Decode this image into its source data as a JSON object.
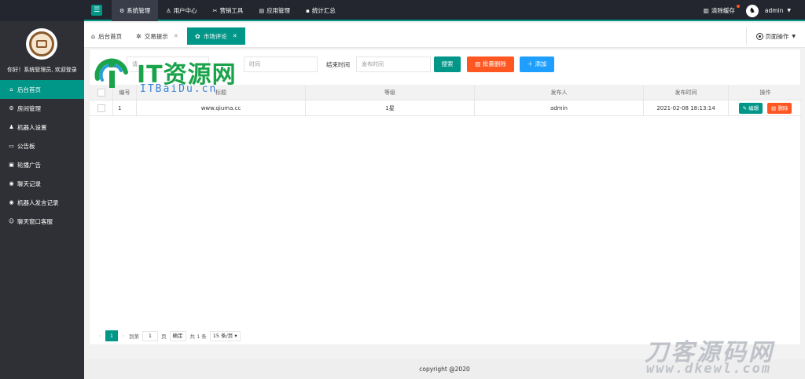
{
  "sidebar": {
    "welcome": "你好！系统管理员, 欢迎登录",
    "items": [
      {
        "icon": "home-icon",
        "glyph": "⌂",
        "label": "后台首页"
      },
      {
        "icon": "settings-icon",
        "glyph": "⚙",
        "label": "房间管理"
      },
      {
        "icon": "user-icon",
        "glyph": "♟",
        "label": "机器人设置"
      },
      {
        "icon": "board-icon",
        "glyph": "▭",
        "label": "公告板"
      },
      {
        "icon": "image-icon",
        "glyph": "▣",
        "label": "轮播广告"
      },
      {
        "icon": "chat-icon",
        "glyph": "◉",
        "label": "聊天记录"
      },
      {
        "icon": "robot-icon",
        "glyph": "◉",
        "label": "机器人发言记录"
      },
      {
        "icon": "service-icon",
        "glyph": "☺",
        "label": "聊天窗口客服"
      }
    ]
  },
  "topbar": {
    "tabs": [
      {
        "icon": "gear-icon",
        "glyph": "⚙",
        "label": "系统管理"
      },
      {
        "icon": "user-icon",
        "glyph": "♙",
        "label": "用户中心"
      },
      {
        "icon": "tools-icon",
        "glyph": "✂",
        "label": "营销工具"
      },
      {
        "icon": "app-icon",
        "glyph": "▤",
        "label": "应用管理"
      },
      {
        "icon": "stats-icon",
        "glyph": "▪",
        "label": "统计汇总"
      }
    ],
    "clear_cache": "清除缓存",
    "user": "admin"
  },
  "tabstrip": {
    "tabs": [
      {
        "icon": "home-icon",
        "glyph": "⌂",
        "label": "后台首页"
      },
      {
        "icon": "tip-icon",
        "glyph": "✲",
        "label": "交易提示"
      },
      {
        "icon": "market-icon",
        "glyph": "✿",
        "label": "市场评论"
      }
    ],
    "page_ops": "页面操作"
  },
  "search": {
    "keyword_label": "关键",
    "keyword_placeholder": "请",
    "start_placeholder": "时间",
    "end_label": "结束时间",
    "end_placeholder": "发布时间",
    "search_btn": "搜索",
    "batch_delete_btn": "批量删除",
    "add_btn": "添加"
  },
  "table": {
    "headers": [
      "",
      "编号",
      "标题",
      "等级",
      "发布人",
      "发布时间",
      "操作"
    ],
    "rows": [
      {
        "id": "1",
        "title": "www.qiuma.cc",
        "level": "1星",
        "publisher": "admin",
        "time": "2021-02-08 18:13:14",
        "edit": "编辑",
        "delete": "删除"
      }
    ]
  },
  "pager": {
    "current": "1",
    "goto_label": "到第",
    "goto_value": "1",
    "page_unit": "页",
    "confirm": "确定",
    "total": "共 1 条",
    "per_page": "15 条/页"
  },
  "footer": "copyright @2020",
  "watermarks": {
    "top_text": "IT资源网",
    "top_sub": "ITBaiDu.cn",
    "bottom_text": "刀客源码网",
    "bottom_sub": "www.dkewl.com"
  },
  "colors": {
    "accent": "#009688",
    "danger": "#ff5722",
    "info": "#1e9fff",
    "dark": "#23262e"
  }
}
